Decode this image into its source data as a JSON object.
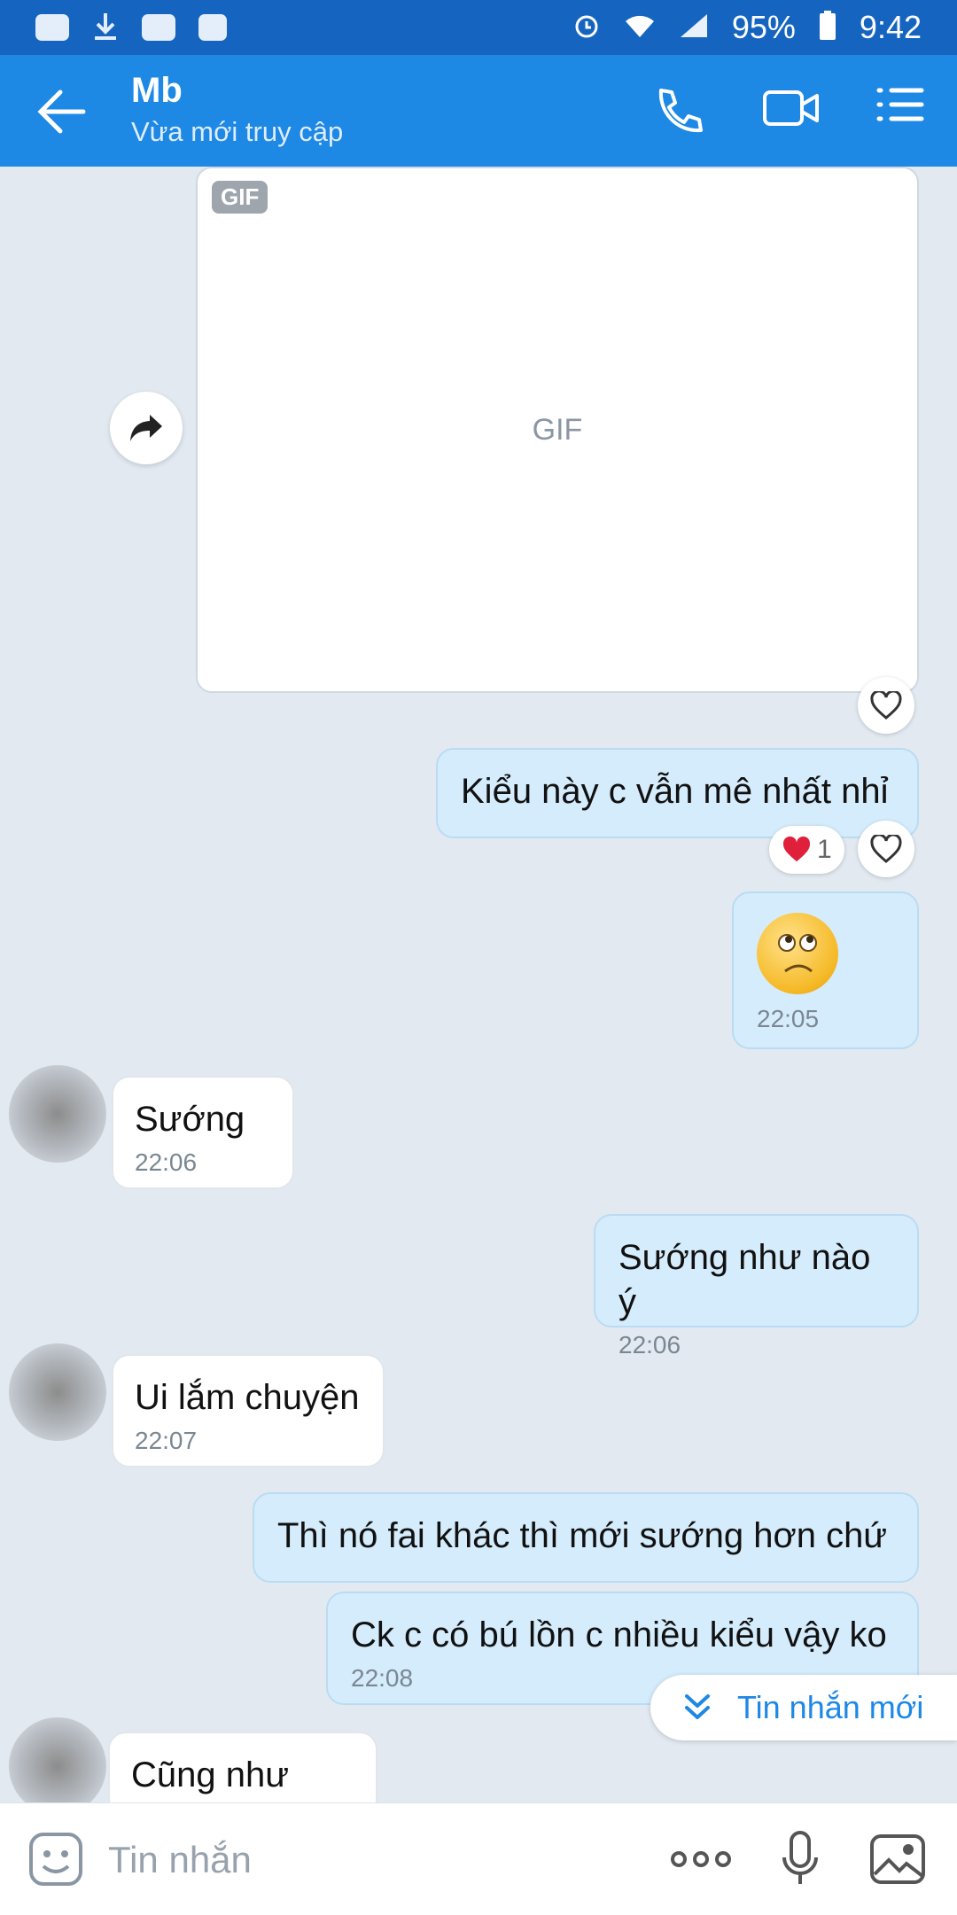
{
  "status_bar": {
    "battery": "95%",
    "time": "9:42"
  },
  "header": {
    "title": "Mb",
    "subtitle": "Vừa mới truy cập"
  },
  "gif": {
    "badge": "GIF",
    "placeholder": "GIF"
  },
  "messages": [
    {
      "text": "Kiểu này c vẫn mê nhất nhỉ"
    },
    {
      "time": "22:05"
    },
    {
      "text": "Sướng",
      "time": "22:06"
    },
    {
      "text": "Sướng như nào ý",
      "time": "22:06"
    },
    {
      "text": "Ui lắm chuyện",
      "time": "22:07"
    },
    {
      "text": "Thì nó fai khác thì mới sướng hơn chứ"
    },
    {
      "text": "Ck c có bú lồn c nhiều kiểu vậy ko",
      "time": "22:08"
    },
    {
      "text": "Cũng như vậy"
    }
  ],
  "reaction": {
    "count": "1"
  },
  "new_messages_label": "Tin nhắn mới",
  "input": {
    "placeholder": "Tin nhắn"
  },
  "colors": {
    "header": "#1e88e5",
    "status_bar": "#1565c0",
    "outgoing_bubble": "#d5ecfc",
    "background": "#e2e9f1"
  }
}
